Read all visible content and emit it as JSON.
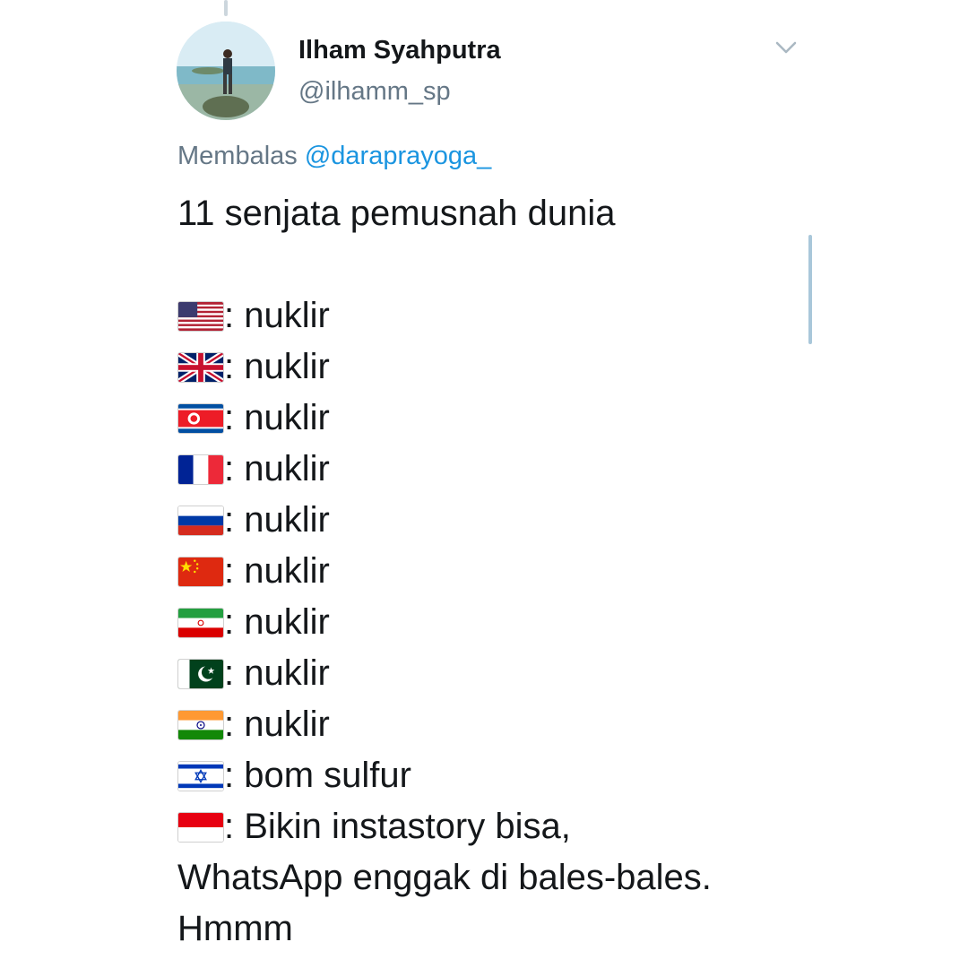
{
  "tweet": {
    "author_name": "Ilham Syahputra",
    "author_handle": "@ilhamm_sp",
    "reply_prefix": "Membalas",
    "reply_mention": "@daraprayoga_",
    "title": "11 senjata pemusnah dunia",
    "items": [
      {
        "flag": "us-flag",
        "text": ": nuklir"
      },
      {
        "flag": "uk-flag",
        "text": ": nuklir"
      },
      {
        "flag": "north-korea-flag",
        "text": ": nuklir"
      },
      {
        "flag": "france-flag",
        "text": ": nuklir"
      },
      {
        "flag": "russia-flag",
        "text": ": nuklir"
      },
      {
        "flag": "china-flag",
        "text": ": nuklir"
      },
      {
        "flag": "iran-flag",
        "text": ": nuklir"
      },
      {
        "flag": "pakistan-flag",
        "text": ": nuklir"
      },
      {
        "flag": "india-flag",
        "text": ": nuklir"
      },
      {
        "flag": "israel-flag",
        "text": ": bom sulfur"
      },
      {
        "flag": "indonesia-flag",
        "text": ": Bikin instastory bisa,"
      }
    ],
    "continuation_lines": [
      "WhatsApp enggak di bales-bales.",
      "Hmmm"
    ]
  },
  "icons": {
    "menu": "chevron-down-icon",
    "avatar": "profile-photo"
  },
  "colors": {
    "text": "#14171a",
    "secondary": "#657786",
    "link": "#1b95e0"
  }
}
